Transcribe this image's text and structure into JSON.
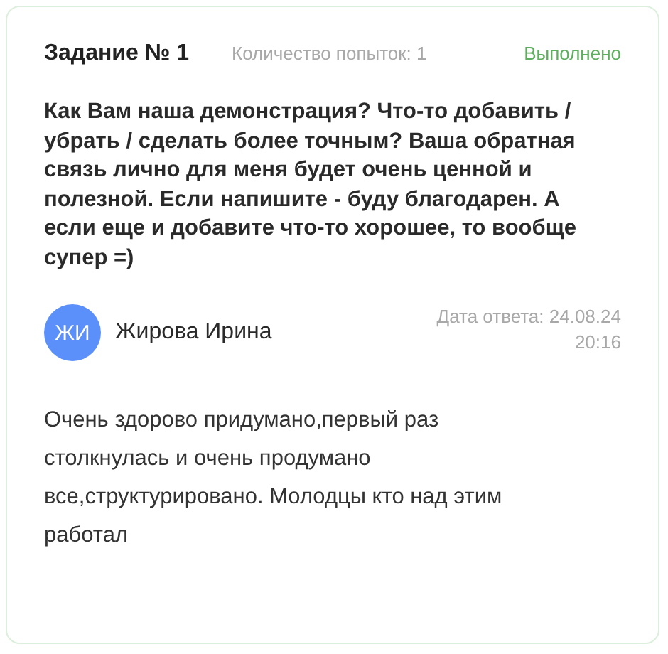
{
  "task": {
    "title": "Задание № 1",
    "attempts": "Количество попыток: 1",
    "status": {
      "text": "Выполнено",
      "kind": "done"
    },
    "question": "Как Вам наша демонстрация? Что-то добавить / убрать / сделать более точным? Ваша обратная связь лично для меня будет очень ценной и полезной. Если напишите - буду благодарен. А если еще и добавите что-то хорошее, то вообще супер =)",
    "answer": {
      "avatar": "ЖИ",
      "color": "#5b8ff9",
      "author": "Жирова Ирина",
      "date": "Дата ответа: 24.08.24",
      "time": "20:16",
      "text": "Очень здорово придумано,первый раз столкнулась и очень продумано все,структурировано. Молодцы кто над этим работал"
    }
  }
}
